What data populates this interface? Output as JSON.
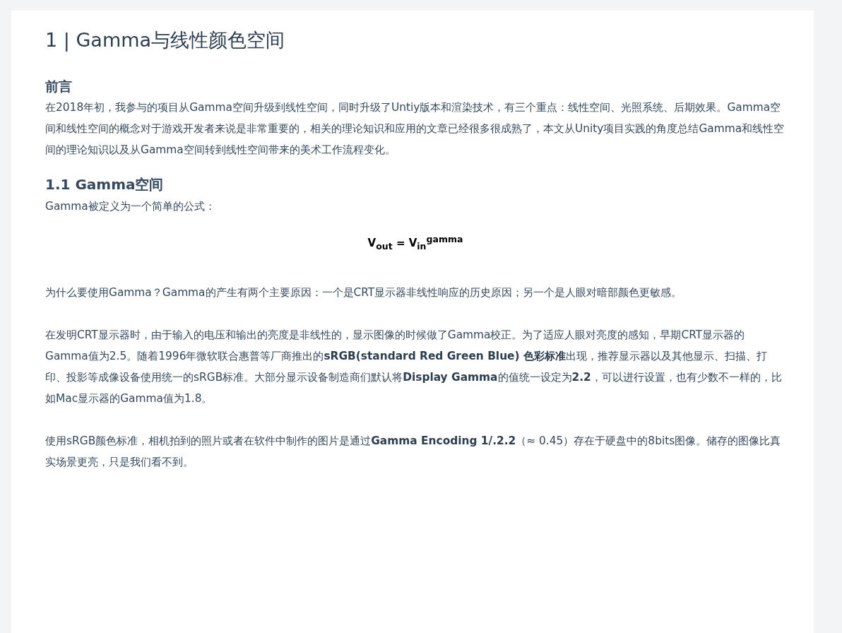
{
  "article": {
    "title": "1 | Gamma与线性颜色空间",
    "blocks": [
      {
        "kind": "subheading",
        "text": "前言"
      },
      {
        "kind": "paragraph",
        "text": "在2018年初，我参与的项目从Gamma空间升级到线性空间，同时升级了Untiy版本和渲染技术，有三个重点：线性空间、光照系统、后期效果。Gamma空间和线性空间的概念对于游戏开发者来说是非常重要的，相关的理论知识和应用的文章已经很多很成熟了，本文从Unity项目实践的角度总结Gamma和线性空间的理论知识以及从Gamma空间转到线性空间带来的美术工作流程变化。"
      },
      {
        "kind": "section",
        "text": "1.1 Gamma空间"
      },
      {
        "kind": "paragraph",
        "text": "Gamma被定义为一个简单的公式："
      },
      {
        "kind": "formula",
        "text": "V$_{out}$ = V$_{in}$$^{gamma}$"
      },
      {
        "kind": "paragraph",
        "text": "为什么要使用Gamma？Gamma的产生有两个主要原因：一个是CRT显示器非线性响应的历史原因；另一个是人眼对暗部颜色更敏感。"
      },
      {
        "kind": "paragraph",
        "text": "在发明CRT显示器时，由于输入的电压和输出的亮度是非线性的，显示图像的时候做了Gamma校正。为了适应人眼对亮度的感知，早期CRT显示器的Gamma值为2.5。随着1996年微软联合惠普等厂商推出的**sRGB(standard Red Green Blue) 色彩标准**出现，推荐显示器以及其他显示、扫描、打印、投影等成像设备使用统一的sRGB标准。大部分显示设备制造商们默认将**Display Gamma**的值统一设定为**2.2**，可以进行设置，也有少数不一样的，比如Mac显示器的Gamma值为1.8。"
      },
      {
        "kind": "paragraph",
        "text": "使用sRGB颜色标准，相机拍到的照片或者在软件中制作的图片是通过**Gamma Encoding 1/.2.2**（≈ 0.45）存在于硬盘中的8bits图像。储存的图像比真实场景更亮，只是我们看不到。"
      }
    ]
  }
}
